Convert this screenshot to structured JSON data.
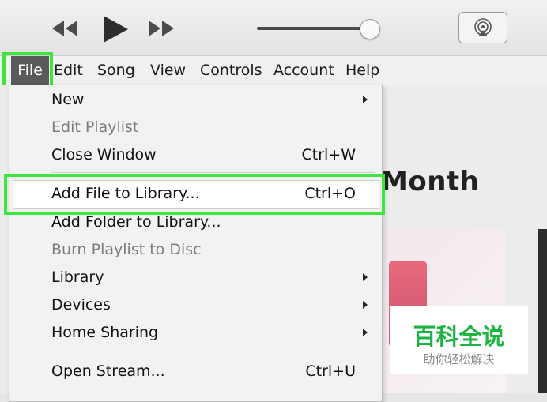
{
  "toolbar": {
    "icons": [
      "rewind-icon",
      "play-icon",
      "fast-forward-icon",
      "volume-slider",
      "airplay-icon"
    ],
    "volume_level": 0.92
  },
  "menubar": {
    "items": [
      "File",
      "Edit",
      "Song",
      "View",
      "Controls",
      "Account",
      "Help"
    ],
    "active": "File"
  },
  "file_menu": {
    "items": [
      {
        "label": "New",
        "shortcut": "",
        "submenu": true,
        "enabled": true
      },
      {
        "label": "Edit Playlist",
        "shortcut": "",
        "submenu": false,
        "enabled": false
      },
      {
        "label": "Close Window",
        "shortcut": "Ctrl+W",
        "submenu": false,
        "enabled": true
      },
      {
        "label": "Add File to Library...",
        "shortcut": "Ctrl+O",
        "submenu": false,
        "enabled": true
      },
      {
        "label": "Add Folder to Library...",
        "shortcut": "",
        "submenu": false,
        "enabled": true
      },
      {
        "label": "Burn Playlist to Disc",
        "shortcut": "",
        "submenu": false,
        "enabled": false
      },
      {
        "label": "Library",
        "shortcut": "",
        "submenu": true,
        "enabled": true
      },
      {
        "label": "Devices",
        "shortcut": "",
        "submenu": true,
        "enabled": true
      },
      {
        "label": "Home Sharing",
        "shortcut": "",
        "submenu": true,
        "enabled": true
      },
      {
        "label": "Open Stream...",
        "shortcut": "Ctrl+U",
        "submenu": false,
        "enabled": true
      }
    ],
    "highlighted": "Add File to Library..."
  },
  "background": {
    "heading": "Month"
  },
  "watermark": {
    "main": "百科全说",
    "sub": "助你轻松解决"
  },
  "colors": {
    "highlight_border": "#3fe43f",
    "active_menu_bg": "#5a5a5a",
    "watermark_green": "#1db444"
  }
}
